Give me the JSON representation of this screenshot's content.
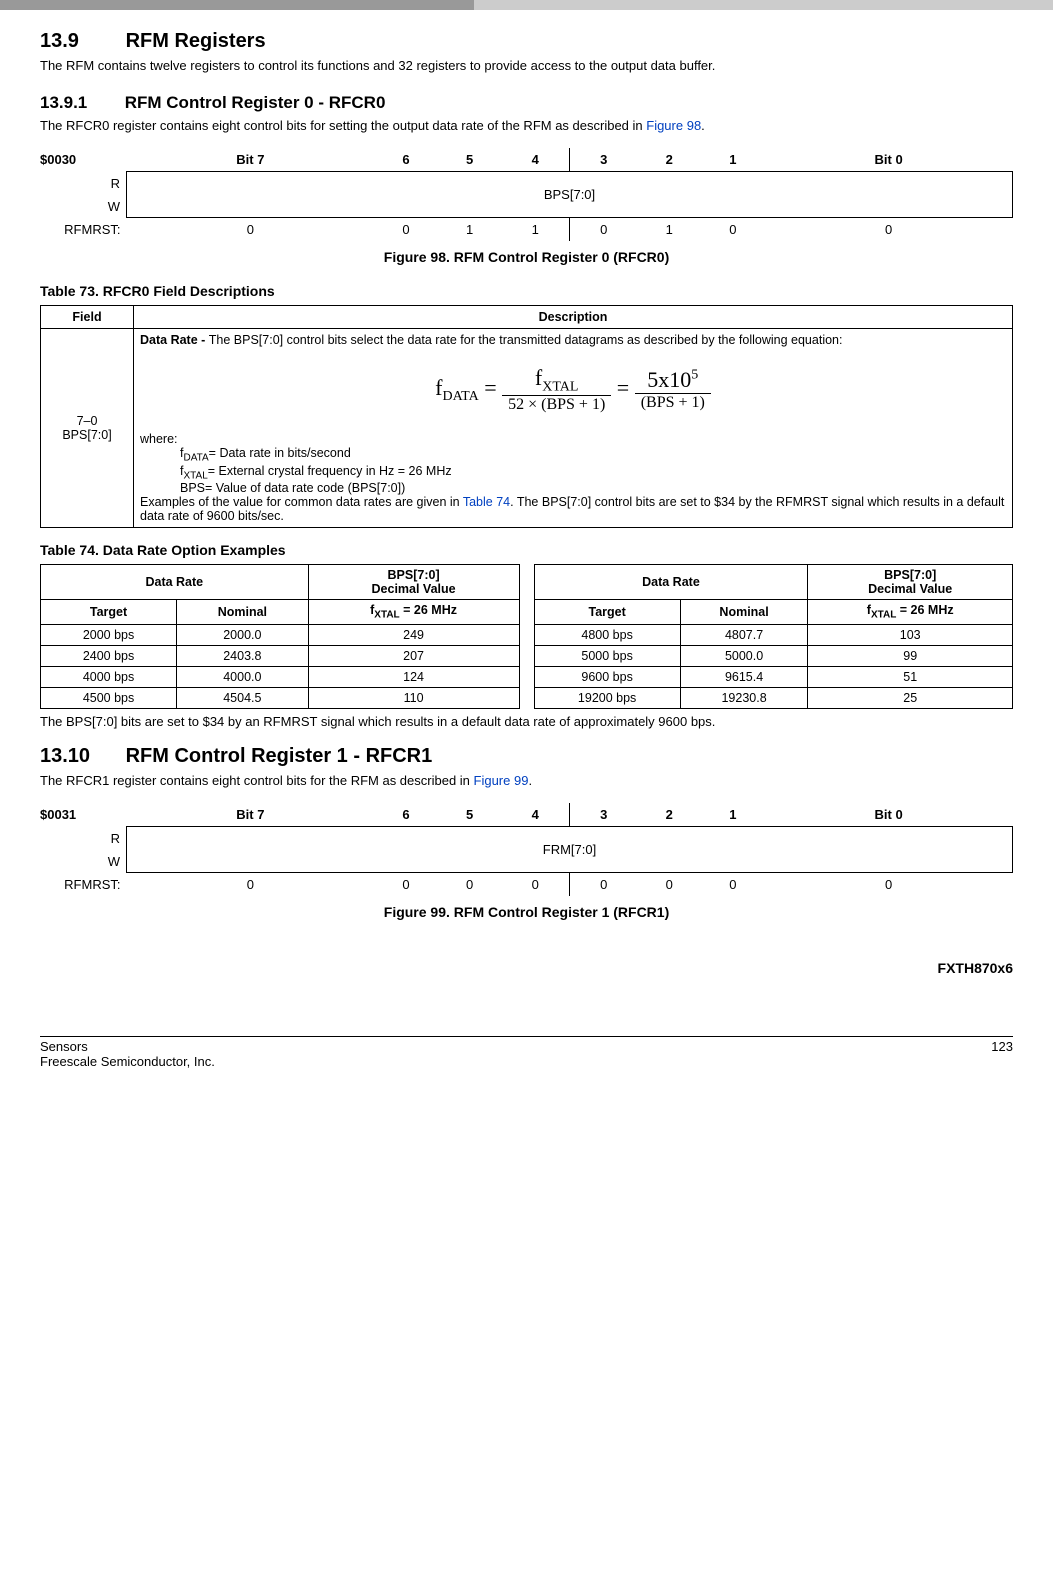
{
  "section139": {
    "num": "13.9",
    "title": "RFM Registers",
    "intro": "The RFM contains twelve registers to control its functions and 32 registers to provide access to the output data buffer."
  },
  "section1391": {
    "num": "13.9.1",
    "title": "RFM Control Register 0 - RFCR0",
    "intro_pre": "The RFCR0 register contains eight control bits for setting the output data rate of the RFM as described in ",
    "intro_link": "Figure 98",
    "intro_post": "."
  },
  "reg0": {
    "addr": "$0030",
    "bits": [
      "Bit 7",
      "6",
      "5",
      "4",
      "3",
      "2",
      "1",
      "Bit 0"
    ],
    "rw_r": "R",
    "rw_w": "W",
    "field": "BPS[7:0]",
    "reset_label": "RFMRST:",
    "reset": [
      "0",
      "0",
      "1",
      "1",
      "0",
      "1",
      "0",
      "0"
    ],
    "caption": "Figure 98. RFM Control Register 0 (RFCR0)"
  },
  "table73": {
    "caption": "Table 73. RFCR0 Field Descriptions",
    "field_hdr": "Field",
    "desc_hdr": "Description",
    "field_name_line1": "7–0",
    "field_name_line2": "BPS[7:0]",
    "desc_lead_bold": "Data Rate - ",
    "desc_lead_rest": "The BPS[7:0] control bits select the data rate for the transmitted datagrams as described by the following equation:",
    "eqn": {
      "lhs_base": "f",
      "lhs_sub": "DATA",
      "eq": " = ",
      "f1_num_base": "f",
      "f1_num_sub": "XTAL",
      "f1_den": "52 × (BPS + 1)",
      "f2_num_pre": "5x10",
      "f2_num_sup": "5",
      "f2_den": "(BPS + 1)"
    },
    "where": "where:",
    "defs": [
      {
        "sym_base": "f",
        "sym_sub": "DATA",
        "rest": "= Data rate in bits/second"
      },
      {
        "sym_base": "f",
        "sym_sub": "XTAL",
        "rest": "= External crystal frequency in Hz = 26 MHz"
      },
      {
        "sym_base": "",
        "sym_sub": "",
        "rest": "BPS= Value of data rate code (BPS[7:0])"
      }
    ],
    "tail_pre": "Examples of the value for common data rates are given in ",
    "tail_link": "Table 74",
    "tail_mid": ". The BPS[7:0] control bits are set to $34 by the RFMRST signal which results in a default data rate of 9600 bits/sec."
  },
  "table74": {
    "caption": "Table 74. Data Rate Option Examples",
    "hdr_rate": "Data Rate",
    "hdr_bps_l1": "BPS[7:0]",
    "hdr_bps_l2": "Decimal Value",
    "hdr_target": "Target",
    "hdr_nominal": "Nominal",
    "hdr_fx_pre": "f",
    "hdr_fx_sub": "XTAL",
    "hdr_fx_post": " = 26 MHz",
    "left_rows": [
      {
        "t": "2000 bps",
        "n": "2000.0",
        "b": "249"
      },
      {
        "t": "2400 bps",
        "n": "2403.8",
        "b": "207"
      },
      {
        "t": "4000 bps",
        "n": "4000.0",
        "b": "124"
      },
      {
        "t": "4500 bps",
        "n": "4504.5",
        "b": "110"
      }
    ],
    "right_rows": [
      {
        "t": "4800 bps",
        "n": "4807.7",
        "b": "103"
      },
      {
        "t": "5000 bps",
        "n": "5000.0",
        "b": "99"
      },
      {
        "t": "9600 bps",
        "n": "9615.4",
        "b": "51"
      },
      {
        "t": "19200 bps",
        "n": "19230.8",
        "b": "25"
      }
    ],
    "note": "The BPS[7:0] bits are set to $34 by an RFMRST signal which results in a default data rate of approximately 9600 bps."
  },
  "section1310": {
    "num": "13.10",
    "title": "RFM Control Register 1 - RFCR1",
    "intro_pre": "The RFCR1 register contains eight control bits for the RFM as described in ",
    "intro_link": "Figure 99",
    "intro_post": "."
  },
  "reg1": {
    "addr": "$0031",
    "bits": [
      "Bit 7",
      "6",
      "5",
      "4",
      "3",
      "2",
      "1",
      "Bit 0"
    ],
    "rw_r": "R",
    "rw_w": "W",
    "field": "FRM[7:0]",
    "reset_label": "RFMRST:",
    "reset": [
      "0",
      "0",
      "0",
      "0",
      "0",
      "0",
      "0",
      "0"
    ],
    "caption": "Figure 99. RFM Control Register 1 (RFCR1)"
  },
  "footer": {
    "device": "FXTH870x6",
    "left1": "Sensors",
    "left2": "Freescale Semiconductor, Inc.",
    "page": "123"
  }
}
